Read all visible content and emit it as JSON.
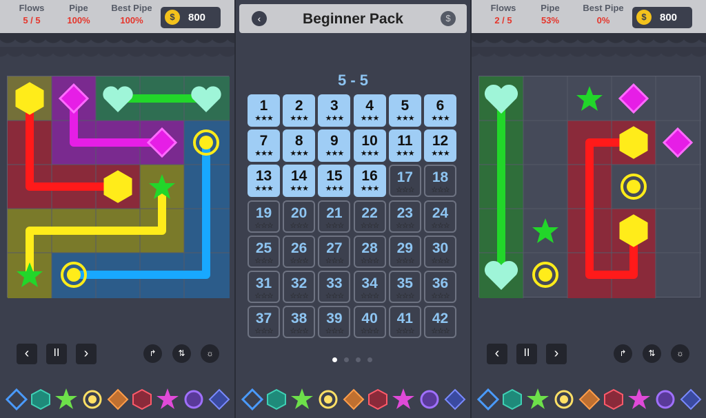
{
  "left": {
    "hud": {
      "flows_label": "Flows",
      "flows_value": "5 / 5",
      "pipe_label": "Pipe",
      "pipe_value": "100%",
      "best_label": "Best Pipe",
      "best_value": "100%",
      "coins": "800"
    }
  },
  "right": {
    "hud": {
      "flows_label": "Flows",
      "flows_value": "2 / 5",
      "pipe_label": "Pipe",
      "pipe_value": "53%",
      "best_label": "Best Pipe",
      "best_value": "0%",
      "coins": "800"
    }
  },
  "middle": {
    "title": "Beginner Pack",
    "level_label": "5 - 5",
    "levels": [
      {
        "n": "1",
        "stars": "★★★",
        "done": true
      },
      {
        "n": "2",
        "stars": "★★★",
        "done": true
      },
      {
        "n": "3",
        "stars": "★★★",
        "done": true
      },
      {
        "n": "4",
        "stars": "★★★",
        "done": true
      },
      {
        "n": "5",
        "stars": "★★★",
        "done": true
      },
      {
        "n": "6",
        "stars": "★★★",
        "done": true
      },
      {
        "n": "7",
        "stars": "★★★",
        "done": true
      },
      {
        "n": "8",
        "stars": "★★★",
        "done": true
      },
      {
        "n": "9",
        "stars": "★★★",
        "done": true
      },
      {
        "n": "10",
        "stars": "★★★",
        "done": true
      },
      {
        "n": "11",
        "stars": "★★★",
        "done": true
      },
      {
        "n": "12",
        "stars": "★★★",
        "done": true
      },
      {
        "n": "13",
        "stars": "★★★",
        "done": true
      },
      {
        "n": "14",
        "stars": "★★★",
        "done": true
      },
      {
        "n": "15",
        "stars": "★★★",
        "done": true
      },
      {
        "n": "16",
        "stars": "★★★",
        "done": true
      },
      {
        "n": "17",
        "stars": "☆☆☆",
        "done": false
      },
      {
        "n": "18",
        "stars": "☆☆☆",
        "done": false
      },
      {
        "n": "19",
        "stars": "☆☆☆",
        "done": false
      },
      {
        "n": "20",
        "stars": "☆☆☆",
        "done": false
      },
      {
        "n": "21",
        "stars": "☆☆☆",
        "done": false
      },
      {
        "n": "22",
        "stars": "☆☆☆",
        "done": false
      },
      {
        "n": "23",
        "stars": "☆☆☆",
        "done": false
      },
      {
        "n": "24",
        "stars": "☆☆☆",
        "done": false
      },
      {
        "n": "25",
        "stars": "☆☆☆",
        "done": false
      },
      {
        "n": "26",
        "stars": "☆☆☆",
        "done": false
      },
      {
        "n": "27",
        "stars": "☆☆☆",
        "done": false
      },
      {
        "n": "28",
        "stars": "☆☆☆",
        "done": false
      },
      {
        "n": "29",
        "stars": "☆☆☆",
        "done": false
      },
      {
        "n": "30",
        "stars": "☆☆☆",
        "done": false
      },
      {
        "n": "31",
        "stars": "☆☆☆",
        "done": false
      },
      {
        "n": "32",
        "stars": "☆☆☆",
        "done": false
      },
      {
        "n": "33",
        "stars": "☆☆☆",
        "done": false
      },
      {
        "n": "34",
        "stars": "☆☆☆",
        "done": false
      },
      {
        "n": "35",
        "stars": "☆☆☆",
        "done": false
      },
      {
        "n": "36",
        "stars": "☆☆☆",
        "done": false
      },
      {
        "n": "37",
        "stars": "☆☆☆",
        "done": false
      },
      {
        "n": "38",
        "stars": "☆☆☆",
        "done": false
      },
      {
        "n": "39",
        "stars": "☆☆☆",
        "done": false
      },
      {
        "n": "40",
        "stars": "☆☆☆",
        "done": false
      },
      {
        "n": "41",
        "stars": "☆☆☆",
        "done": false
      },
      {
        "n": "42",
        "stars": "☆☆☆",
        "done": false
      }
    ],
    "page_dots": 4,
    "active_page": 1
  },
  "controls": {
    "prev_icon": "chevron-left-icon",
    "pause_icon": "pause-icon",
    "next_icon": "chevron-right-icon",
    "hint_icons": [
      "star-path-icon",
      "route-icon",
      "bulb-icon"
    ]
  },
  "shape_palette": [
    "diamond-blue",
    "hexagon-teal",
    "star-green",
    "circle-yellow",
    "diamond-orange",
    "hexagon-red",
    "star-pink",
    "circle-purple",
    "diamond-indigo"
  ],
  "colors": {
    "red": "#ff1a1a",
    "magenta": "#e61ee6",
    "mint": "#9ff5d8",
    "yellow": "#ffec1a",
    "blue": "#18a8ff",
    "green": "#22d62a",
    "level_done": "#9fcdf5",
    "accent_text": "#8ec5f2",
    "hud_bg": "#c9cace"
  }
}
